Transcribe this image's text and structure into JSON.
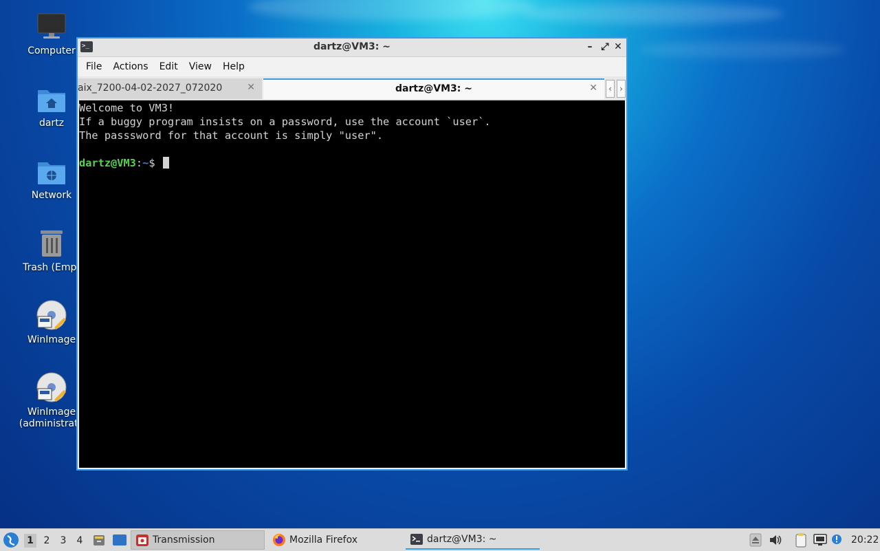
{
  "desktop": {
    "icons": [
      {
        "label": "Computer",
        "icon": "monitor-icon"
      },
      {
        "label": "dartz",
        "icon": "home-folder-icon"
      },
      {
        "label": "Network",
        "icon": "network-folder-icon"
      },
      {
        "label": "Trash (Empt",
        "icon": "trash-icon"
      },
      {
        "label": "WinImage",
        "icon": "winimage-icon"
      },
      {
        "label": "WinImage",
        "label2": "(administrato",
        "icon": "winimage-icon"
      }
    ]
  },
  "window": {
    "title": "dartz@VM3: ~",
    "controls": {
      "minimize": "–",
      "maximize": "⤢",
      "close": "✕"
    },
    "menu": [
      "File",
      "Actions",
      "Edit",
      "View",
      "Help"
    ],
    "tabs": [
      {
        "label": "aix_7200-04-02-2027_072020",
        "active": false
      },
      {
        "label": "dartz@VM3: ~",
        "active": true
      }
    ],
    "tab_close": "✕",
    "tab_scroll_left": "‹",
    "tab_scroll_right": "›",
    "terminal": {
      "lines": [
        "Welcome to VM3!",
        "If a buggy program insists on a password, use the account `user`.",
        "The passsword for that account is simply \"user\".",
        ""
      ],
      "prompt_user": "dartz@VM3",
      "prompt_sep": ":",
      "prompt_path": "~",
      "prompt_symbol": "$ "
    }
  },
  "taskbar": {
    "start_icon": "lxqt-menu-icon",
    "desktops": [
      "1",
      "2",
      "3",
      "4"
    ],
    "active_desktop": "1",
    "tasks": [
      {
        "label": "Transmission",
        "icon": "transmission-icon",
        "active": false
      },
      {
        "label": "Mozilla Firefox",
        "icon": "firefox-icon",
        "active": false
      },
      {
        "label": "dartz@VM3: ~",
        "icon": "terminal-icon",
        "active": true
      }
    ],
    "clock": "20:22"
  },
  "colors": {
    "accent": "#3c9be6",
    "prompt_user": "#55d34c",
    "prompt_path": "#3a7de0",
    "terminal_bg": "#000000",
    "terminal_fg": "#d3d3d3"
  }
}
